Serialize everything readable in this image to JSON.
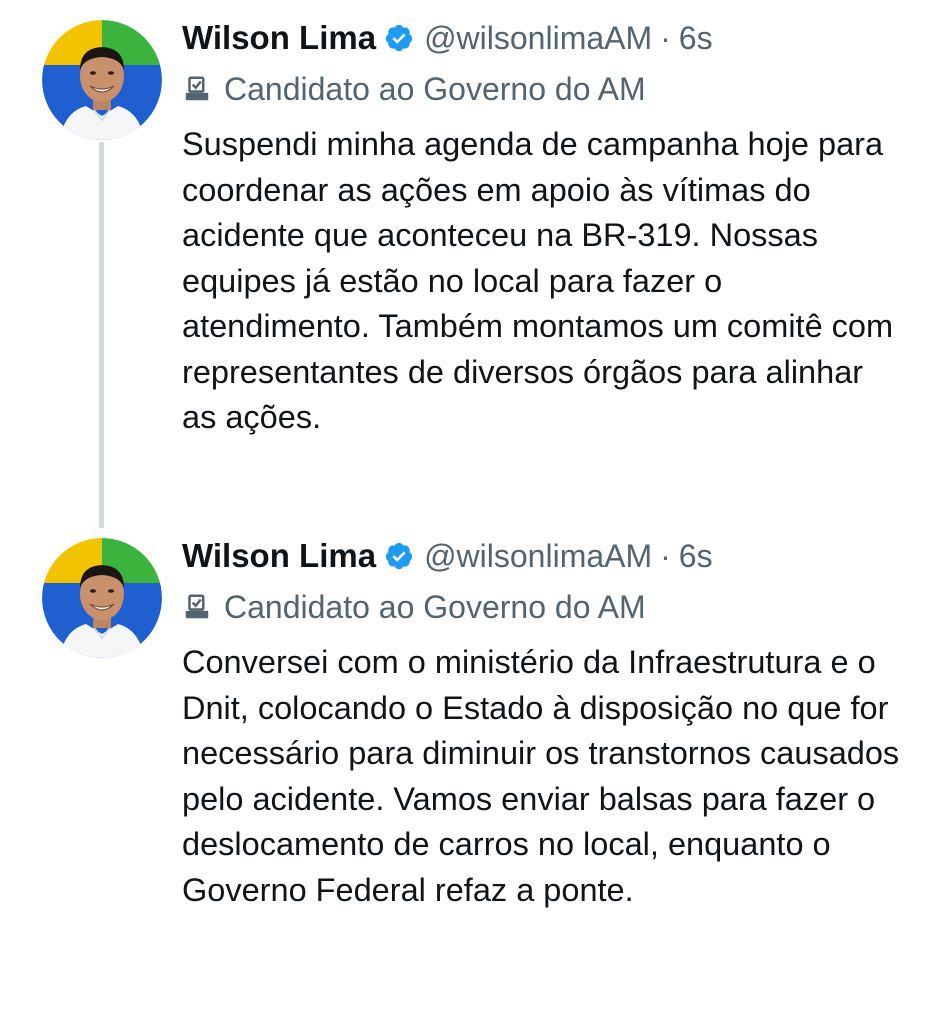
{
  "tweets": [
    {
      "author": {
        "name": "Wilson Lima",
        "handle": "@wilsonlimaAM",
        "verified": true,
        "avatar": "avatar-photo"
      },
      "separator": "·",
      "time": "6s",
      "affiliation": {
        "icon": "ballot-box-icon",
        "text": "Candidato ao Governo do AM"
      },
      "text": "Suspendi minha agenda de campanha hoje para coordenar as ações em apoio às vítimas do acidente que aconteceu na BR-319. Nossas equipes já estão no local para fazer o atendimento. Também montamos um comitê com representantes de diversos órgãos para alinhar as ações."
    },
    {
      "author": {
        "name": "Wilson Lima",
        "handle": "@wilsonlimaAM",
        "verified": true,
        "avatar": "avatar-photo"
      },
      "separator": "·",
      "time": "6s",
      "affiliation": {
        "icon": "ballot-box-icon",
        "text": "Candidato ao Governo do AM"
      },
      "text": "Conversei com o ministério da Infraestrutura e o Dnit, colocando o Estado à disposição no que for necessário para diminuir os transtornos causados pelo acidente. Vamos enviar balsas para fazer o deslocamento de carros no local, enquanto o Governo Federal refaz a ponte."
    }
  ],
  "colors": {
    "verified": "#1d9bf0",
    "secondary_text": "#536471",
    "primary_text": "#0f1419",
    "thread_line": "#cfd9de",
    "avatar_ring_top_left": "#f2c300",
    "avatar_ring_top_right": "#3cb33c",
    "avatar_ring_bottom": "#1f5fcf"
  }
}
